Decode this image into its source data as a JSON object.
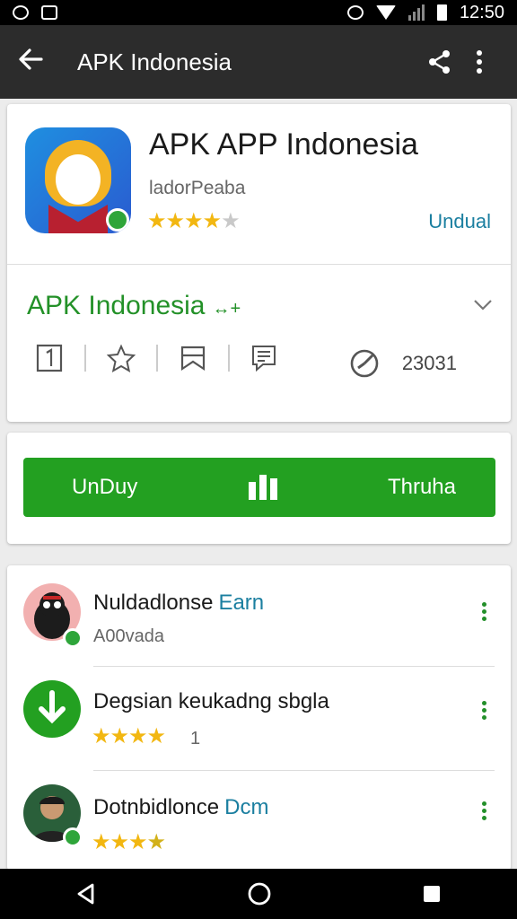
{
  "status_bar": {
    "time": "12:50"
  },
  "app_bar": {
    "title": "APK Indonesia"
  },
  "app": {
    "title": "APK APP Indonesia",
    "developer": "ladorPeaba",
    "rating_stars": 3.5,
    "action_label": "Undual"
  },
  "section": {
    "title": "APK Indonesia",
    "title_suffix": "↔+",
    "count": "23031"
  },
  "install_bar": {
    "left_label": "UnDuy",
    "right_label": "Thruha"
  },
  "list": [
    {
      "title": "Nuldadlonse",
      "tag": "Earn",
      "subtitle": "A00vada",
      "rating_stars": 0
    },
    {
      "title": "Degsian keukadng sbgla",
      "tag": "",
      "subtitle": "1",
      "rating_stars": 3.5
    },
    {
      "title": "Dotnbidlonce",
      "tag": "Dcm",
      "subtitle": "",
      "rating_stars": 3.5
    }
  ],
  "colors": {
    "accent_green": "#23a021",
    "link_blue": "#1b7fa0",
    "star_gold": "#f2b711"
  }
}
